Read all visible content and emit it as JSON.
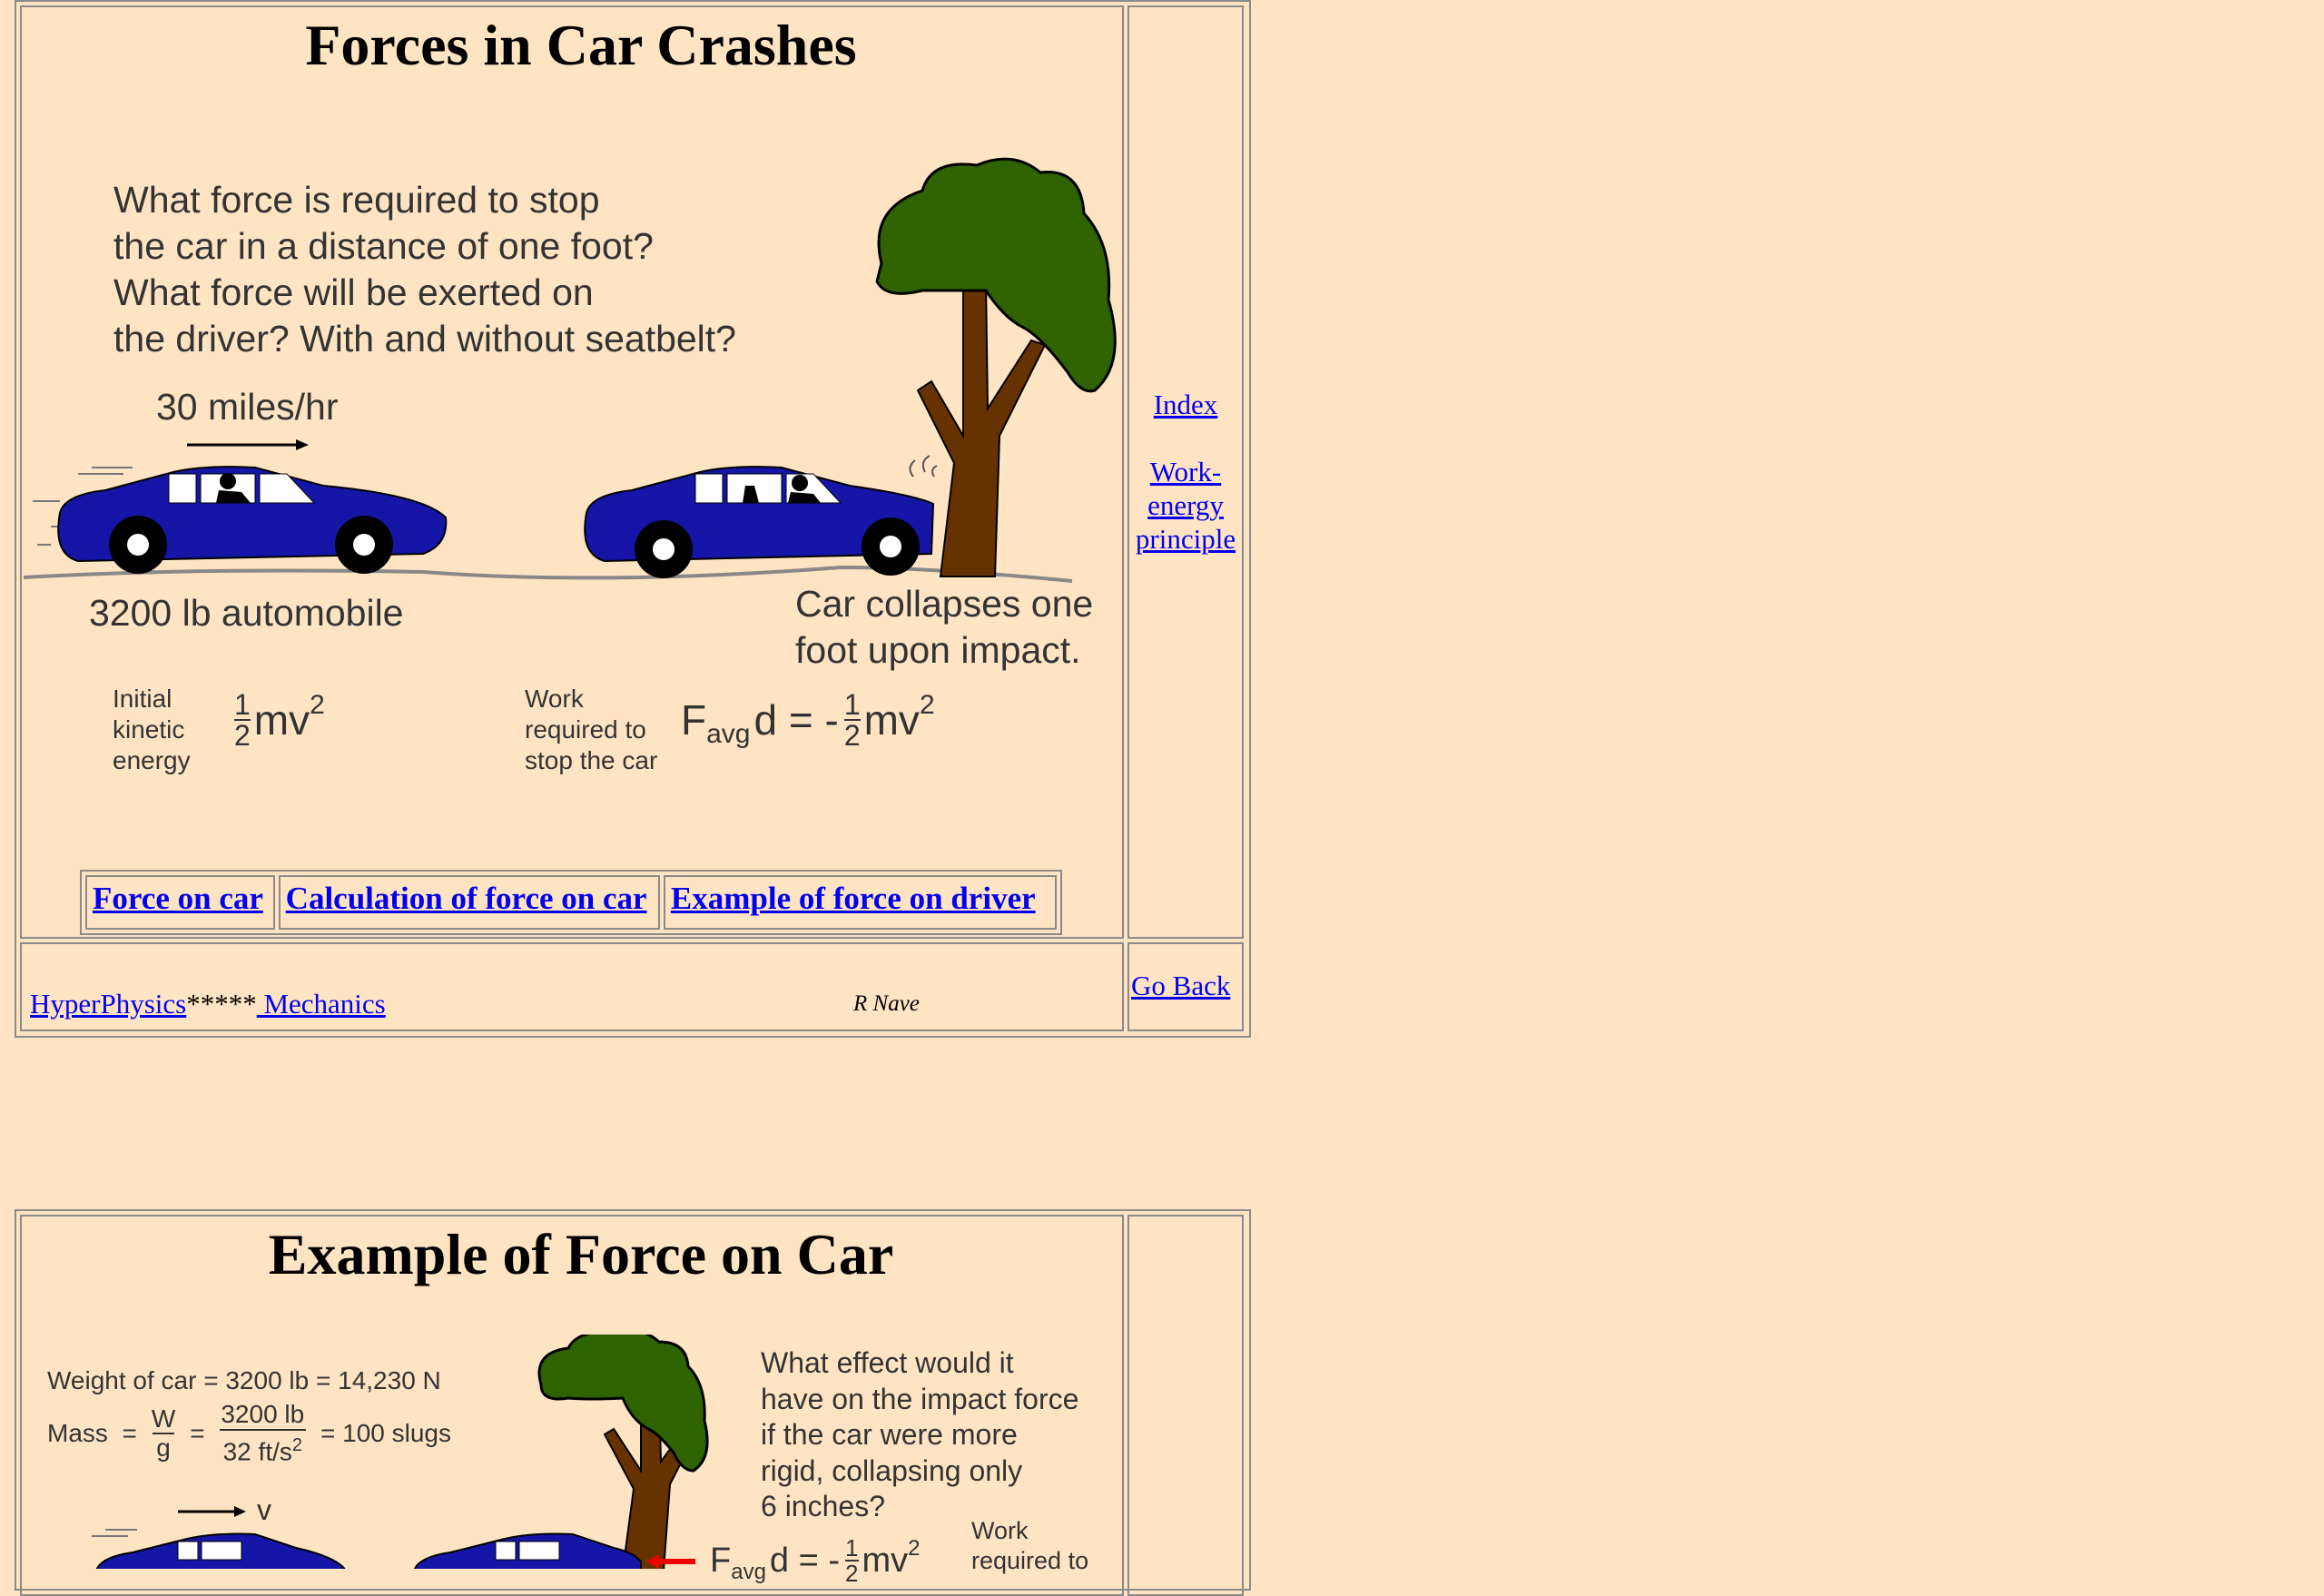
{
  "section1": {
    "title": "Forces in Car Crashes",
    "question": [
      "What force is required to stop",
      "the car in a distance of one foot?",
      "What force will be exerted on",
      "the driver? With and without seatbelt?"
    ],
    "speed_label": "30 miles/hr",
    "mass_label": "3200 lb automobile",
    "collapse_label": [
      "Car collapses one",
      "foot upon impact."
    ],
    "ke_label": [
      "Initial",
      "kinetic",
      "energy"
    ],
    "work_label": [
      "Work",
      "required to",
      "stop the car"
    ],
    "formula_ke": "mv",
    "formula_work_lhs": "F",
    "formula_work_sub": "avg",
    "formula_work_mid": "d = -",
    "formula_work_rhs": "mv",
    "nav_links": [
      "Force on car",
      "Calculation of force on car",
      "Example of force on driver"
    ],
    "side_links": [
      "Index",
      "Work-energy principle"
    ],
    "footer": {
      "hyperphysics": "HyperPhysics",
      "stars": "*****",
      "mechanics": " Mechanics",
      "author": "R Nave",
      "go_back": "Go Back"
    }
  },
  "section2": {
    "title": "Example of Force on Car",
    "weight_line": "Weight of car = 3200 lb = 14,230 N",
    "mass_prefix": "Mass  =",
    "frac_w_num": "W",
    "frac_w_den": "g",
    "equals": "=",
    "frac_lb_num": "3200 lb",
    "frac_lb_den": "32 ft/s",
    "mass_result": "= 100 slugs",
    "question": [
      "What effect would it",
      "have on the impact force",
      "if the car were more",
      "rigid, collapsing only",
      "6 inches?"
    ],
    "v_label": "v",
    "work_label": [
      "Work",
      "required to"
    ],
    "formula": "d = -",
    "formula_rhs": "mv"
  },
  "colors": {
    "background": "#ffe4c4",
    "car": "#1515a8",
    "tree_leaves": "#2f6300",
    "tree_trunk": "#663300",
    "link": "#0000ee"
  }
}
